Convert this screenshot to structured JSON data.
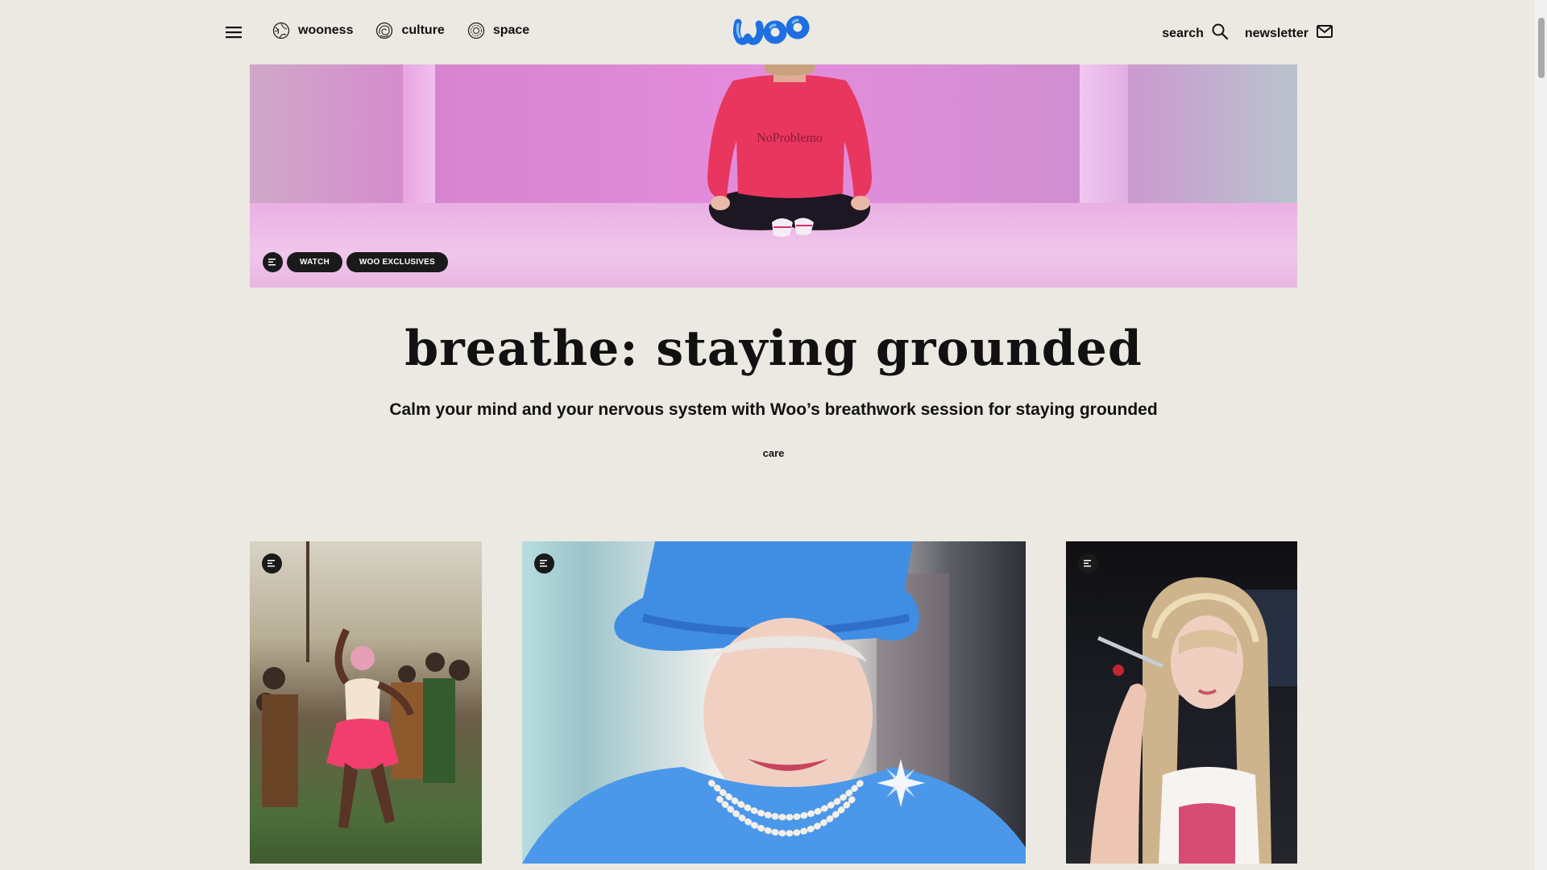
{
  "nav": {
    "menu_icon": "hamburger-menu-icon",
    "items": [
      {
        "label": "wooness",
        "icon": "globe-pattern-icon"
      },
      {
        "label": "culture",
        "icon": "spiral-icon"
      },
      {
        "label": "space",
        "icon": "concentric-circles-icon"
      }
    ],
    "logo_text": "woo",
    "search_label": "search",
    "search_icon": "search-icon",
    "newsletter_label": "newsletter",
    "newsletter_icon": "envelope-icon"
  },
  "hero": {
    "image": "person in pink sweatshirt sitting cross-legged in pink studio",
    "sweatshirt_text": "NoProblemo",
    "tags": [
      "WATCH",
      "WOO EXCLUSIVES"
    ],
    "tag_icon": "text-lines-icon"
  },
  "article": {
    "title": "breathe: staying grounded",
    "subtitle": "Calm your mind and your nervous system with Woo’s breathwork session for staying grounded",
    "category": "care"
  },
  "cards": [
    {
      "image": "dancer in pink skirt performing in crowd under tent",
      "icon": "text-lines-icon"
    },
    {
      "image": "smiling woman in blue hat and pearl necklace",
      "icon": "text-lines-icon"
    },
    {
      "image": "woman with blonde hair applying eye makeup",
      "icon": "text-lines-icon"
    }
  ],
  "colors": {
    "background": "#ebe9e2",
    "logo_blue": "#2b7de9",
    "tag_bg": "#1a1a1a"
  }
}
